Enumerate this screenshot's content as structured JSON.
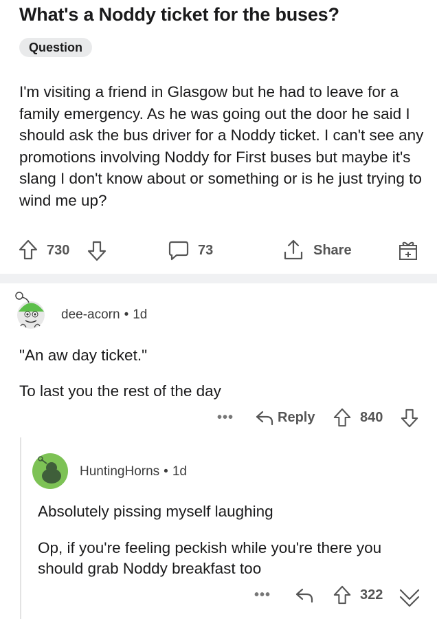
{
  "post": {
    "title": "What's a Noddy ticket for the buses?",
    "flair": "Question",
    "body": "I'm visiting a friend in Glasgow but he had to leave for a family emergency. As he was going out the door he said I should ask the bus driver for a Noddy ticket. I can't see any promotions involving Noddy for First buses but maybe it's slang I don't know about or something or is he just trying to wind me up?",
    "upvotes": "730",
    "comments": "73",
    "share_label": "Share"
  },
  "comments": [
    {
      "username": "dee-acorn",
      "separator": "•",
      "age": "1d",
      "paragraphs": [
        "\"An aw day ticket.\"",
        "To last you the rest of the day"
      ],
      "more_label": "•••",
      "reply_label": "Reply",
      "votes": "840"
    },
    {
      "username": "HuntingHorns",
      "separator": "•",
      "age": "1d",
      "paragraphs": [
        "Absolutely pissing myself laughing",
        "Op, if you're feeling peckish while you're there you should grab Noddy breakfast too"
      ],
      "more_label": "•••",
      "votes": "322"
    }
  ],
  "icons": {
    "upvote": "upvote-arrow-icon",
    "downvote": "downvote-arrow-icon",
    "comment": "comment-bubble-icon",
    "share": "share-icon",
    "award": "award-gift-icon",
    "reply": "reply-arrow-icon",
    "collapse": "chevron-down-icon"
  },
  "colors": {
    "avatar_green_1": "#5cbf4a",
    "avatar_green_2": "#7dc255",
    "flair_bg": "#e9eaeb",
    "divider": "#f0f1f3"
  }
}
